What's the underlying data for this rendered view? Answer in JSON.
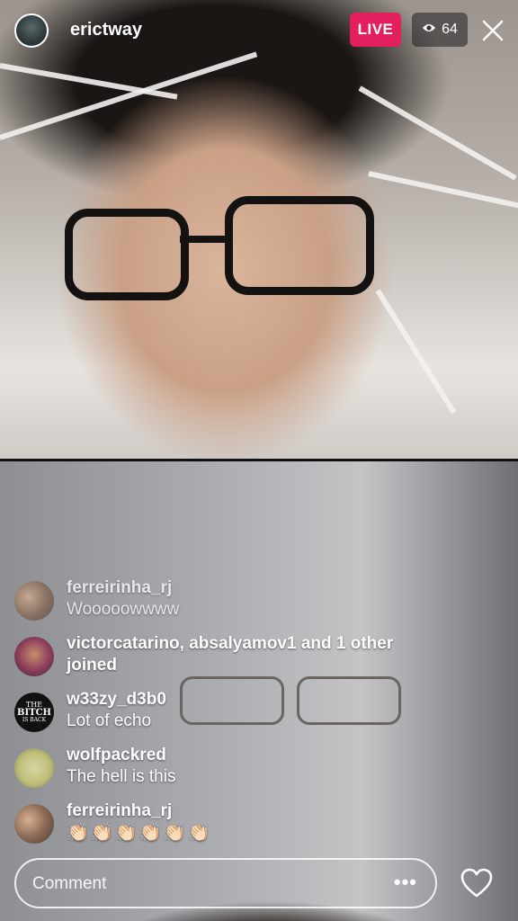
{
  "header": {
    "username": "erictway",
    "live_label": "LIVE",
    "viewer_count": "64"
  },
  "comments": [
    {
      "user": "ferreirinha_rj",
      "text": "Wooooowwww"
    },
    {
      "user": "victorcatarino, absalyamov1 and 1 other joined",
      "text": ""
    },
    {
      "user": "w33zy_d3b0",
      "text": "Lot of echo"
    },
    {
      "user": "wolfpackred",
      "text": "The hell is this"
    },
    {
      "user": "ferreirinha_rj",
      "text": "👏🏻👏🏻👏🏻👏🏻👏🏻👏🏻"
    }
  ],
  "avatar_badge": {
    "line1": "THE",
    "line2": "BITCH",
    "line3": "IS BACK"
  },
  "footer": {
    "comment_placeholder": "Comment",
    "more_label": "•••"
  },
  "colors": {
    "live": "#e3205d"
  },
  "icons": [
    "eye-icon",
    "close-icon",
    "more-icon",
    "heart-icon"
  ]
}
